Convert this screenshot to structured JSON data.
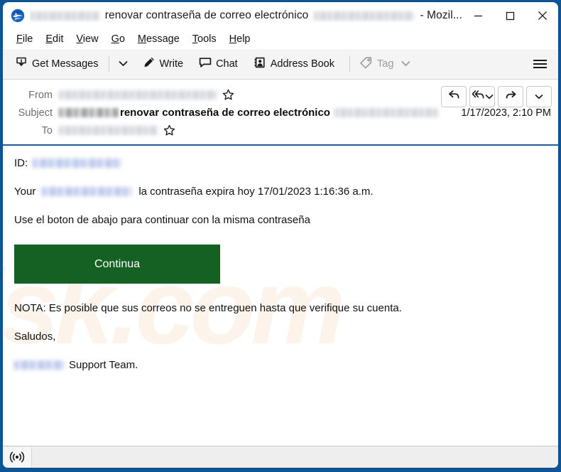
{
  "window": {
    "title_visible": "renovar contraseña de correo electrónico",
    "title_suffix": "- Mozil...",
    "app_icon": "thunderbird-icon",
    "controls": {
      "minimize": "minimize-icon",
      "maximize": "maximize-icon",
      "close": "close-icon"
    }
  },
  "menubar": {
    "items": [
      {
        "label": "File",
        "accel": "F"
      },
      {
        "label": "Edit",
        "accel": "E"
      },
      {
        "label": "View",
        "accel": "V"
      },
      {
        "label": "Go",
        "accel": "G"
      },
      {
        "label": "Message",
        "accel": "M"
      },
      {
        "label": "Tools",
        "accel": "T"
      },
      {
        "label": "Help",
        "accel": "H"
      }
    ]
  },
  "toolbar": {
    "get_messages": "Get Messages",
    "get_messages_icon": "download-inbox-icon",
    "get_messages_chevron": "chevron-down-icon",
    "write": "Write",
    "write_icon": "pencil-icon",
    "chat": "Chat",
    "chat_icon": "speech-bubble-icon",
    "address_book": "Address Book",
    "address_book_icon": "address-book-icon",
    "tag": "Tag",
    "tag_icon": "tag-icon",
    "tag_chevron": "chevron-down-icon",
    "tag_disabled": true,
    "app_menu_icon": "hamburger-icon"
  },
  "message_header": {
    "from_label": "From",
    "from_value_redacted": true,
    "subject_label": "Subject",
    "subject_prefix_redacted": true,
    "subject_value": "renovar contraseña de correo electrónico",
    "subject_suffix_redacted": true,
    "to_label": "To",
    "to_value_redacted": true,
    "date": "1/17/2023, 2:10 PM",
    "star_icon": "star-outline-icon",
    "actions": {
      "reply": "reply-icon",
      "reply_all": "reply-all-icon",
      "reply_all_chevron": "chevron-down-icon",
      "forward": "forward-icon",
      "more_chevron": "chevron-down-icon"
    }
  },
  "body": {
    "line_id_label": "ID:",
    "line_id_redacted": true,
    "line_expire_prefix": "Your",
    "line_expire_redacted": true,
    "line_expire_suffix": "la contraseña expira hoy 17/01/2023 1:16:36 a.m.",
    "line_instruction": "Use el boton de abajo para continuar con la misma contraseña",
    "cta_label": "Continua",
    "cta_color": "#146123",
    "line_note": "NOTA: Es posible que sus correos no se entreguen hasta que verifique su cuenta.",
    "line_greeting": "Saludos,",
    "line_signature_redacted": true,
    "line_signature_suffix": "Support Team.",
    "watermark_a": "isk.com",
    "watermark_b": "//"
  },
  "statusbar": {
    "connection_icon": "broadcast-online-icon",
    "text": ""
  },
  "colors": {
    "window_frame": "#0c5596",
    "toolbar_bg": "#f4f4f4",
    "header_rule": "#1b5e9e",
    "cta_green": "#146123",
    "status_bg": "#eeeeee"
  }
}
